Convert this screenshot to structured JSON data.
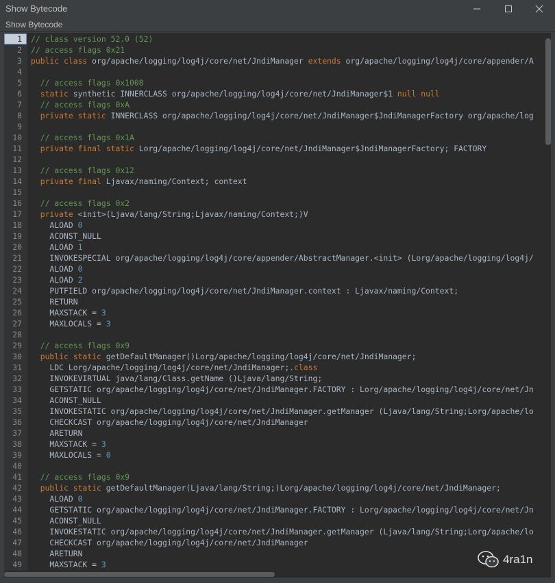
{
  "window": {
    "title": "Show Bytecode",
    "tool_window_title": "Show Bytecode"
  },
  "icons": {
    "minimize": "minimize-icon",
    "maximize": "maximize-icon",
    "close": "close-icon",
    "watermark": "wechat-logo-icon"
  },
  "colors": {
    "keyword": "#cc7832",
    "comment": "#629755",
    "number": "#6897bb",
    "text": "#a9b7c6"
  },
  "watermark": {
    "text": "4ra1n"
  },
  "lines": [
    {
      "n": "1",
      "tokens": [
        {
          "t": "// class version 52.0 (52)",
          "c": "cm"
        }
      ]
    },
    {
      "n": "2",
      "tokens": [
        {
          "t": "// access flags 0x21",
          "c": "cm"
        }
      ]
    },
    {
      "n": "3",
      "tokens": [
        {
          "t": "public class ",
          "c": "kw"
        },
        {
          "t": "org/apache/logging/log4j/core/net/JndiManager ",
          "c": ""
        },
        {
          "t": "extends ",
          "c": "kw"
        },
        {
          "t": "org/apache/logging/log4j/core/appender/A",
          "c": ""
        }
      ]
    },
    {
      "n": "4",
      "tokens": []
    },
    {
      "n": "5",
      "tokens": [
        {
          "t": "  // access flags 0x1008",
          "c": "cm"
        }
      ]
    },
    {
      "n": "6",
      "tokens": [
        {
          "t": "  static ",
          "c": "kw"
        },
        {
          "t": "synthetic INNERCLASS org/apache/logging/log4j/core/net/JndiManager$1 ",
          "c": ""
        },
        {
          "t": "null null",
          "c": "kw"
        }
      ]
    },
    {
      "n": "7",
      "tokens": [
        {
          "t": "  // access flags 0xA",
          "c": "cm"
        }
      ]
    },
    {
      "n": "8",
      "tokens": [
        {
          "t": "  private static ",
          "c": "kw"
        },
        {
          "t": "INNERCLASS org/apache/logging/log4j/core/net/JndiManager$JndiManagerFactory org/apache/log",
          "c": ""
        }
      ]
    },
    {
      "n": "9",
      "tokens": []
    },
    {
      "n": "10",
      "tokens": [
        {
          "t": "  // access flags 0x1A",
          "c": "cm"
        }
      ]
    },
    {
      "n": "11",
      "tokens": [
        {
          "t": "  private final static ",
          "c": "kw"
        },
        {
          "t": "Lorg/apache/logging/log4j/core/net/JndiManager$JndiManagerFactory; FACTORY",
          "c": ""
        }
      ]
    },
    {
      "n": "12",
      "tokens": []
    },
    {
      "n": "13",
      "tokens": [
        {
          "t": "  // access flags 0x12",
          "c": "cm"
        }
      ]
    },
    {
      "n": "14",
      "tokens": [
        {
          "t": "  private final ",
          "c": "kw"
        },
        {
          "t": "Ljavax/naming/Context; context",
          "c": ""
        }
      ]
    },
    {
      "n": "15",
      "tokens": []
    },
    {
      "n": "16",
      "tokens": [
        {
          "t": "  // access flags 0x2",
          "c": "cm"
        }
      ]
    },
    {
      "n": "17",
      "tokens": [
        {
          "t": "  private ",
          "c": "kw"
        },
        {
          "t": "<init>(Ljava/lang/String;Ljavax/naming/Context;)V",
          "c": ""
        }
      ]
    },
    {
      "n": "18",
      "tokens": [
        {
          "t": "    ALOAD ",
          "c": ""
        },
        {
          "t": "0",
          "c": "num"
        }
      ]
    },
    {
      "n": "19",
      "tokens": [
        {
          "t": "    ACONST_NULL",
          "c": ""
        }
      ]
    },
    {
      "n": "20",
      "tokens": [
        {
          "t": "    ALOAD ",
          "c": ""
        },
        {
          "t": "1",
          "c": "num"
        }
      ]
    },
    {
      "n": "21",
      "tokens": [
        {
          "t": "    INVOKESPECIAL org/apache/logging/log4j/core/appender/AbstractManager.<init> (Lorg/apache/logging/log4j/",
          "c": ""
        }
      ]
    },
    {
      "n": "22",
      "tokens": [
        {
          "t": "    ALOAD ",
          "c": ""
        },
        {
          "t": "0",
          "c": "num"
        }
      ]
    },
    {
      "n": "23",
      "tokens": [
        {
          "t": "    ALOAD ",
          "c": ""
        },
        {
          "t": "2",
          "c": "num"
        }
      ]
    },
    {
      "n": "24",
      "tokens": [
        {
          "t": "    PUTFIELD org/apache/logging/log4j/core/net/JndiManager.context : Ljavax/naming/Context;",
          "c": ""
        }
      ]
    },
    {
      "n": "25",
      "tokens": [
        {
          "t": "    RETURN",
          "c": ""
        }
      ]
    },
    {
      "n": "26",
      "tokens": [
        {
          "t": "    MAXSTACK = ",
          "c": ""
        },
        {
          "t": "3",
          "c": "num"
        }
      ]
    },
    {
      "n": "27",
      "tokens": [
        {
          "t": "    MAXLOCALS = ",
          "c": ""
        },
        {
          "t": "3",
          "c": "num"
        }
      ]
    },
    {
      "n": "28",
      "tokens": []
    },
    {
      "n": "29",
      "tokens": [
        {
          "t": "  // access flags 0x9",
          "c": "cm"
        }
      ]
    },
    {
      "n": "30",
      "tokens": [
        {
          "t": "  public static ",
          "c": "kw"
        },
        {
          "t": "getDefaultManager()Lorg/apache/logging/log4j/core/net/JndiManager;",
          "c": ""
        }
      ]
    },
    {
      "n": "31",
      "tokens": [
        {
          "t": "    LDC Lorg/apache/logging/log4j/core/net/JndiManager;.",
          "c": ""
        },
        {
          "t": "class",
          "c": "kw"
        }
      ]
    },
    {
      "n": "32",
      "tokens": [
        {
          "t": "    INVOKEVIRTUAL java/lang/Class.getName ()Ljava/lang/String;",
          "c": ""
        }
      ]
    },
    {
      "n": "33",
      "tokens": [
        {
          "t": "    GETSTATIC org/apache/logging/log4j/core/net/JndiManager.FACTORY : Lorg/apache/logging/log4j/core/net/Jn",
          "c": ""
        }
      ]
    },
    {
      "n": "34",
      "tokens": [
        {
          "t": "    ACONST_NULL",
          "c": ""
        }
      ]
    },
    {
      "n": "35",
      "tokens": [
        {
          "t": "    INVOKESTATIC org/apache/logging/log4j/core/net/JndiManager.getManager (Ljava/lang/String;Lorg/apache/lo",
          "c": ""
        }
      ]
    },
    {
      "n": "36",
      "tokens": [
        {
          "t": "    CHECKCAST org/apache/logging/log4j/core/net/JndiManager",
          "c": ""
        }
      ]
    },
    {
      "n": "37",
      "tokens": [
        {
          "t": "    ARETURN",
          "c": ""
        }
      ]
    },
    {
      "n": "38",
      "tokens": [
        {
          "t": "    MAXSTACK = ",
          "c": ""
        },
        {
          "t": "3",
          "c": "num"
        }
      ]
    },
    {
      "n": "39",
      "tokens": [
        {
          "t": "    MAXLOCALS = ",
          "c": ""
        },
        {
          "t": "0",
          "c": "num"
        }
      ]
    },
    {
      "n": "40",
      "tokens": []
    },
    {
      "n": "41",
      "tokens": [
        {
          "t": "  // access flags 0x9",
          "c": "cm"
        }
      ]
    },
    {
      "n": "42",
      "tokens": [
        {
          "t": "  public static ",
          "c": "kw"
        },
        {
          "t": "getDefaultManager(Ljava/lang/String;)Lorg/apache/logging/log4j/core/net/JndiManager;",
          "c": ""
        }
      ]
    },
    {
      "n": "43",
      "tokens": [
        {
          "t": "    ALOAD ",
          "c": ""
        },
        {
          "t": "0",
          "c": "num"
        }
      ]
    },
    {
      "n": "44",
      "tokens": [
        {
          "t": "    GETSTATIC org/apache/logging/log4j/core/net/JndiManager.FACTORY : Lorg/apache/logging/log4j/core/net/Jn",
          "c": ""
        }
      ]
    },
    {
      "n": "45",
      "tokens": [
        {
          "t": "    ACONST_NULL",
          "c": ""
        }
      ]
    },
    {
      "n": "46",
      "tokens": [
        {
          "t": "    INVOKESTATIC org/apache/logging/log4j/core/net/JndiManager.getManager (Ljava/lang/String;Lorg/apache/lo",
          "c": ""
        }
      ]
    },
    {
      "n": "47",
      "tokens": [
        {
          "t": "    CHECKCAST org/apache/logging/log4j/core/net/JndiManager",
          "c": ""
        }
      ]
    },
    {
      "n": "48",
      "tokens": [
        {
          "t": "    ARETURN",
          "c": ""
        }
      ]
    },
    {
      "n": "49",
      "tokens": [
        {
          "t": "    MAXSTACK = ",
          "c": ""
        },
        {
          "t": "3",
          "c": "num"
        }
      ]
    }
  ]
}
